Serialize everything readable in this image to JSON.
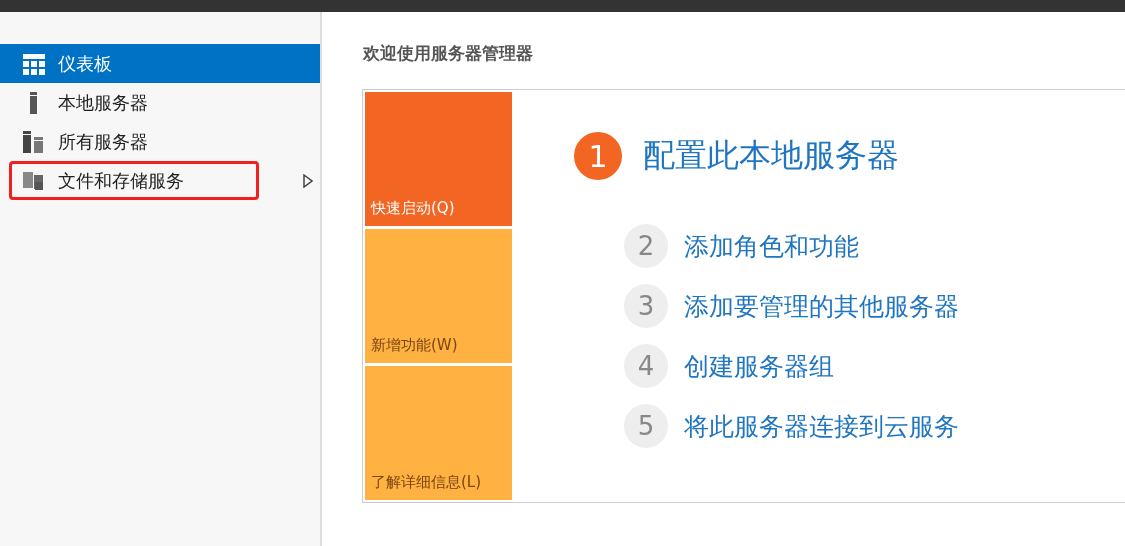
{
  "sidebar": {
    "items": [
      {
        "label": "仪表板",
        "kind": "dashboard",
        "selected": true,
        "highlighted": false,
        "has_arrow": false
      },
      {
        "label": "本地服务器",
        "kind": "server",
        "selected": false,
        "highlighted": false,
        "has_arrow": false
      },
      {
        "label": "所有服务器",
        "kind": "servers",
        "selected": false,
        "highlighted": false,
        "has_arrow": false
      },
      {
        "label": "文件和存储服务",
        "kind": "files",
        "selected": false,
        "highlighted": true,
        "has_arrow": true
      }
    ]
  },
  "main": {
    "title": "欢迎使用服务器管理器",
    "tiles": [
      {
        "label": "快速启动(Q)",
        "color": "#f26522",
        "selected": true
      },
      {
        "label": "新增功能(W)",
        "color": "#ffb142",
        "selected": false
      },
      {
        "label": "了解详细信息(L)",
        "color": "#ffb142",
        "selected": false
      }
    ],
    "steps": [
      {
        "number": "1",
        "label": "配置此本地服务器",
        "active": true
      },
      {
        "number": "2",
        "label": "添加角色和功能",
        "active": false
      },
      {
        "number": "3",
        "label": "添加要管理的其他服务器",
        "active": false
      },
      {
        "number": "4",
        "label": "创建服务器组",
        "active": false
      },
      {
        "number": "5",
        "label": "将此服务器连接到云服务",
        "active": false
      }
    ]
  }
}
